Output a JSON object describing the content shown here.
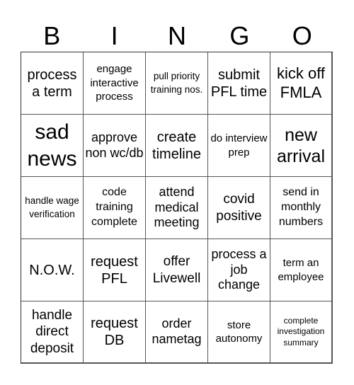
{
  "header": {
    "letters": [
      "B",
      "I",
      "N",
      "G",
      "O"
    ]
  },
  "board": {
    "rows": [
      [
        "process a term",
        "engage interactive process",
        "pull priority training nos.",
        "submit PFL time",
        "kick off FMLA"
      ],
      [
        "sad news",
        "approve non wc/db",
        "create timeline",
        "do interview prep",
        "new arrival"
      ],
      [
        "handle wage verification",
        "code training complete",
        "attend medical meeting",
        "covid positive",
        "send in monthly numbers"
      ],
      [
        "N.O.W.",
        "request PFL",
        "offer Livewell",
        "process a job change",
        "term an employee"
      ],
      [
        "handle direct deposit",
        "request DB",
        "order nametag",
        "store autonomy",
        "complete investigation summary"
      ]
    ]
  }
}
